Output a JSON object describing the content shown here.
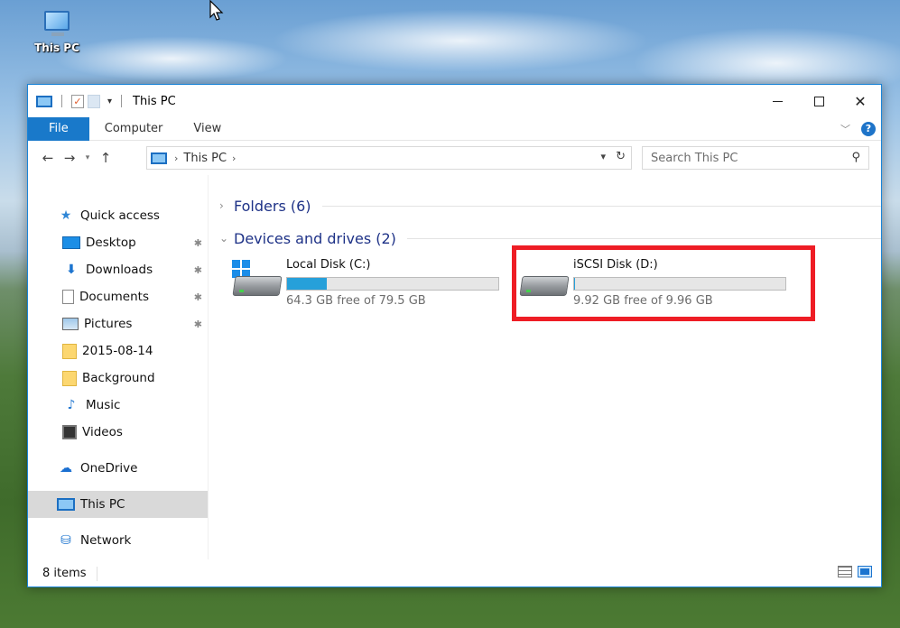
{
  "desktop": {
    "icon_label": "This PC"
  },
  "window": {
    "title": "This PC",
    "controls": {
      "minimize": "—",
      "maximize": "☐",
      "close": "✕"
    }
  },
  "ribbon": {
    "tabs": [
      "File",
      "Computer",
      "View"
    ],
    "help": "?"
  },
  "address": {
    "crumbs": [
      "This PC"
    ],
    "search_placeholder": "Search This PC"
  },
  "nav_pane": {
    "items": [
      {
        "label": "Quick access",
        "icon": "star-icon"
      },
      {
        "label": "Desktop",
        "icon": "desktop-icon",
        "pinned": true
      },
      {
        "label": "Downloads",
        "icon": "download-arrow-icon",
        "pinned": true
      },
      {
        "label": "Documents",
        "icon": "document-icon",
        "pinned": true
      },
      {
        "label": "Pictures",
        "icon": "pictures-icon",
        "pinned": true
      },
      {
        "label": "2015-08-14",
        "icon": "folder-icon"
      },
      {
        "label": "Background",
        "icon": "folder-icon"
      },
      {
        "label": "Music",
        "icon": "music-note-icon"
      },
      {
        "label": "Videos",
        "icon": "video-icon"
      },
      {
        "label": "OneDrive",
        "icon": "cloud-icon"
      },
      {
        "label": "This PC",
        "icon": "computer-icon",
        "selected": true
      },
      {
        "label": "Network",
        "icon": "network-icon"
      }
    ]
  },
  "groups": {
    "folders": "Folders (6)",
    "devices": "Devices and drives (2)"
  },
  "drives": [
    {
      "name": "Local Disk (C:)",
      "free": "64.3 GB free of 79.5 GB",
      "used_fraction": 0.19
    },
    {
      "name": "iSCSI Disk (D:)",
      "free": "9.92 GB free of 9.96 GB",
      "used_fraction": 0.004
    }
  ],
  "colors": {
    "accent": "#1979ca",
    "bar_fill": "#26a0da",
    "highlight": "#ee1d25"
  },
  "status": {
    "item_count": "8 items"
  }
}
